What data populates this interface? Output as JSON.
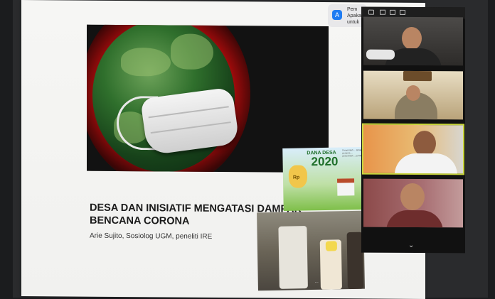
{
  "slide": {
    "title": "DESA DAN INISIATIF MENGATASI DAMPAK BENCANA CORONA",
    "subtitle": "Arie Sujito, Sosiolog UGM, peneliti IRE"
  },
  "dana_desa": {
    "label": "DANA DESA",
    "year": "2020",
    "currency": "Rp",
    "notes": "Pemerintah ... tahap pertama ... pemerintah ... jurnal ..."
  },
  "notification": {
    "line1": "Pem",
    "line2": "Apaka",
    "line3": "untuk",
    "icon": "app-store-icon"
  },
  "photo": {
    "watermark": "..."
  },
  "gallery": {
    "participants": [
      {
        "name_visible": "",
        "active": false
      },
      {
        "name_visible": "",
        "active": false
      },
      {
        "name_visible": "",
        "active": true
      },
      {
        "name_visible": "",
        "active": false
      }
    ],
    "chevron": "chevron-down-icon"
  },
  "colors": {
    "active_speaker_border": "#c8d63c",
    "globe_glow": "#ff2a2a"
  }
}
